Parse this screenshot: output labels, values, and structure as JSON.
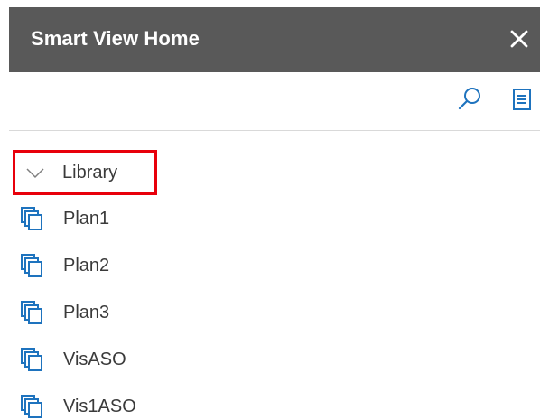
{
  "window": {
    "title": "Smart View Home",
    "close_icon": "close-icon"
  },
  "toolbar": {
    "search_icon": "search-icon",
    "menu_icon": "menu-icon"
  },
  "tree": {
    "root": {
      "label": "Library",
      "icon": "chevron-down-icon",
      "expanded": true,
      "highlighted": true
    },
    "items": [
      {
        "label": "Plan1",
        "icon": "cube-icon"
      },
      {
        "label": "Plan2",
        "icon": "cube-icon"
      },
      {
        "label": "Plan3",
        "icon": "cube-icon"
      },
      {
        "label": "VisASO",
        "icon": "cube-icon"
      },
      {
        "label": "Vis1ASO",
        "icon": "cube-icon"
      }
    ]
  },
  "colors": {
    "titlebar": "#595959",
    "accent": "#1e73be",
    "highlight": "#e8000b",
    "text": "#3a3a3a"
  }
}
